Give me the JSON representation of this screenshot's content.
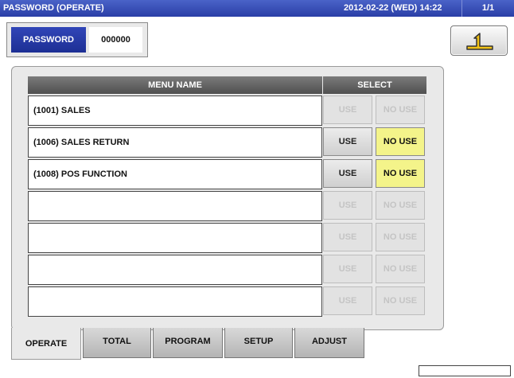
{
  "header": {
    "title": "PASSWORD (OPERATE)",
    "datetime": "2012-02-22 (WED) 14:22",
    "page_indicator": "1/1"
  },
  "password": {
    "label": "PASSWORD",
    "value": "000000"
  },
  "back_button": {
    "icon": "return-arrow-icon"
  },
  "table": {
    "columns": {
      "menu_name": "MENU NAME",
      "select": "SELECT"
    },
    "rows": [
      {
        "name": "(1001) SALES",
        "use_label": "USE",
        "nouse_label": "NO USE",
        "enabled": false,
        "selected": ""
      },
      {
        "name": "(1006) SALES RETURN",
        "use_label": "USE",
        "nouse_label": "NO USE",
        "enabled": true,
        "selected": "NO USE"
      },
      {
        "name": "(1008) POS FUNCTION",
        "use_label": "USE",
        "nouse_label": "NO USE",
        "enabled": true,
        "selected": "NO USE"
      },
      {
        "name": "",
        "use_label": "USE",
        "nouse_label": "NO USE",
        "enabled": false,
        "selected": ""
      },
      {
        "name": "",
        "use_label": "USE",
        "nouse_label": "NO USE",
        "enabled": false,
        "selected": ""
      },
      {
        "name": "",
        "use_label": "USE",
        "nouse_label": "NO USE",
        "enabled": false,
        "selected": ""
      },
      {
        "name": "",
        "use_label": "USE",
        "nouse_label": "NO USE",
        "enabled": false,
        "selected": ""
      }
    ]
  },
  "tabs": [
    {
      "label": "OPERATE",
      "active": true
    },
    {
      "label": "TOTAL",
      "active": false
    },
    {
      "label": "PROGRAM",
      "active": false
    },
    {
      "label": "SETUP",
      "active": false
    },
    {
      "label": "ADJUST",
      "active": false
    }
  ],
  "colors": {
    "title_bar": "#2a3ea6",
    "selected_no_use": "#f4f48a",
    "header_cell": "#505050"
  }
}
